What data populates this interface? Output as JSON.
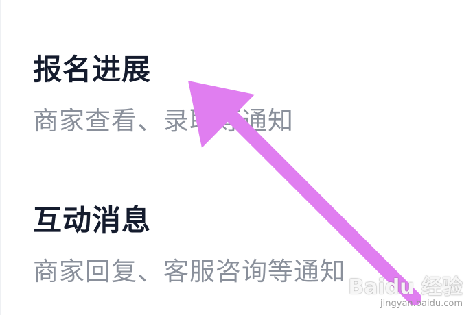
{
  "items": [
    {
      "title": "报名进展",
      "desc": "商家查看、录取等通知"
    },
    {
      "title": "互动消息",
      "desc": "商家回复、客服咨询等通知"
    }
  ],
  "annotation": {
    "color": "#e07ef0",
    "icon": "arrow-annotation-icon"
  },
  "watermark": {
    "brand": "Baidu 经验",
    "url": "jingyan.baidu.com"
  }
}
